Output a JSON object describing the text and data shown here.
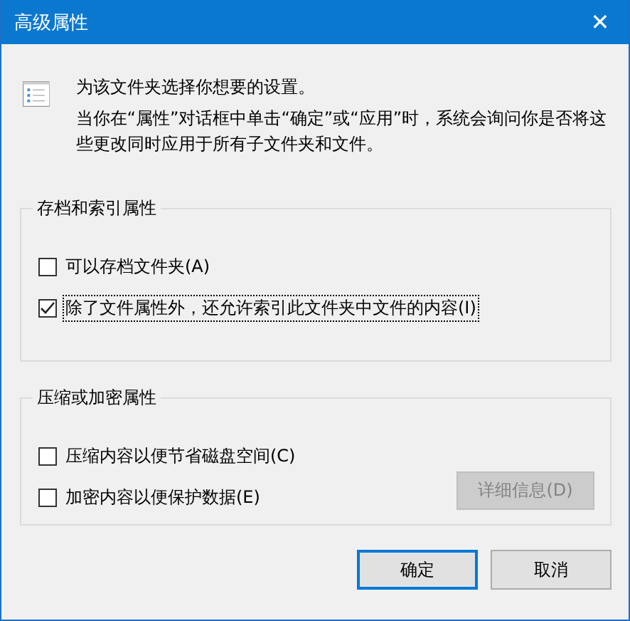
{
  "window": {
    "title": "高级属性",
    "close": "✕"
  },
  "intro": {
    "heading": "为该文件夹选择你想要的设置。",
    "text": "当你在“属性”对话框中单击“确定”或“应用”时，系统会询问你是否将这些更改同时应用于所有子文件夹和文件。"
  },
  "groups": [
    {
      "title": "存档和索引属性",
      "options": [
        {
          "label": "可以存档文件夹(A)",
          "checked": false,
          "focused": false
        },
        {
          "label": "除了文件属性外，还允许索引此文件夹中文件的内容(I)",
          "checked": true,
          "focused": true
        }
      ]
    },
    {
      "title": "压缩或加密属性",
      "options": [
        {
          "label": "压缩内容以便节省磁盘空间(C)",
          "checked": false,
          "focused": false
        },
        {
          "label": "加密内容以便保护数据(E)",
          "checked": false,
          "focused": false
        }
      ],
      "button": {
        "label": "详细信息(D)",
        "disabled": true
      }
    }
  ],
  "buttons": [
    {
      "label": "确定",
      "default": true
    },
    {
      "label": "取消",
      "default": false
    }
  ]
}
